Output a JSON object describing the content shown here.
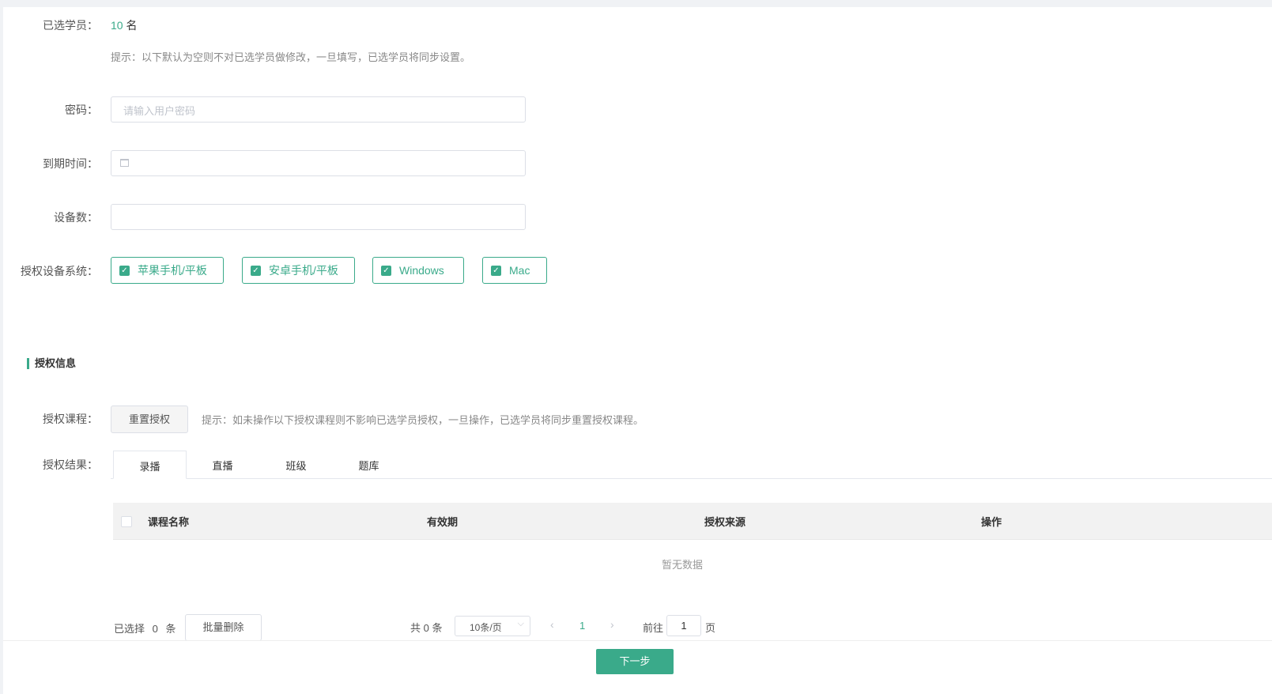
{
  "selected": {
    "label": "已选学员：",
    "count": "10",
    "unit": "名",
    "hint": "提示：以下默认为空则不对已选学员做修改，一旦填写，已选学员将同步设置。"
  },
  "form": {
    "password_label": "密码：",
    "password_placeholder": "请输入用户密码",
    "expire_label": "到期时间：",
    "devices_label": "设备数：",
    "os_label": "授权设备系统："
  },
  "os_options": [
    {
      "label": "苹果手机/平板",
      "checked": true
    },
    {
      "label": "安卓手机/平板",
      "checked": true
    },
    {
      "label": "Windows",
      "checked": true
    },
    {
      "label": "Mac",
      "checked": true
    }
  ],
  "auth": {
    "section_title": "授权信息",
    "course_label": "授权课程：",
    "reset_button": "重置授权",
    "hint": "提示：如未操作以下授权课程则不影响已选学员授权，一旦操作，已选学员将同步重置授权课程。",
    "result_label": "授权结果："
  },
  "tabs": [
    {
      "label": "录播",
      "active": true
    },
    {
      "label": "直播",
      "active": false
    },
    {
      "label": "班级",
      "active": false
    },
    {
      "label": "题库",
      "active": false
    }
  ],
  "table": {
    "columns": [
      "课程名称",
      "有效期",
      "授权来源",
      "操作"
    ],
    "empty_text": "暂无数据"
  },
  "bulk": {
    "selected_prefix": "已选择",
    "selected_count": "0",
    "selected_suffix": "条",
    "delete_button": "批量删除"
  },
  "pagination": {
    "total": "共 0 条",
    "page_size": "10条/页",
    "current_page": "1",
    "goto_label": "前往",
    "goto_value": "1",
    "page_unit": "页"
  },
  "footer": {
    "next_button": "下一步"
  },
  "colors": {
    "accent": "#3aaa8a"
  }
}
